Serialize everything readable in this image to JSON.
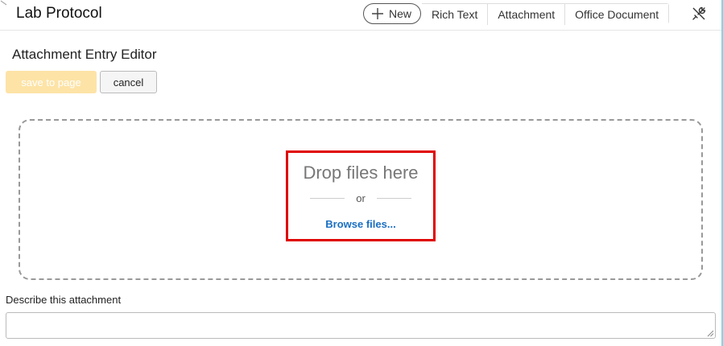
{
  "header": {
    "title": "Lab Protocol",
    "new_label": "New",
    "entry_types": [
      "Rich Text",
      "Attachment",
      "Office Document"
    ],
    "new_icon": "plus-icon",
    "tools_icon": "tools-icon"
  },
  "editor": {
    "title": "Attachment Entry Editor",
    "save_label": "save to page",
    "cancel_label": "cancel"
  },
  "dropzone": {
    "drop_text": "Drop files here",
    "or_text": "or",
    "browse_text": "Browse files..."
  },
  "description": {
    "label": "Describe this attachment",
    "value": ""
  },
  "colors": {
    "save_button_bg": "#fde3a6",
    "link": "#1a6fc2",
    "highlight": "#e00000"
  }
}
